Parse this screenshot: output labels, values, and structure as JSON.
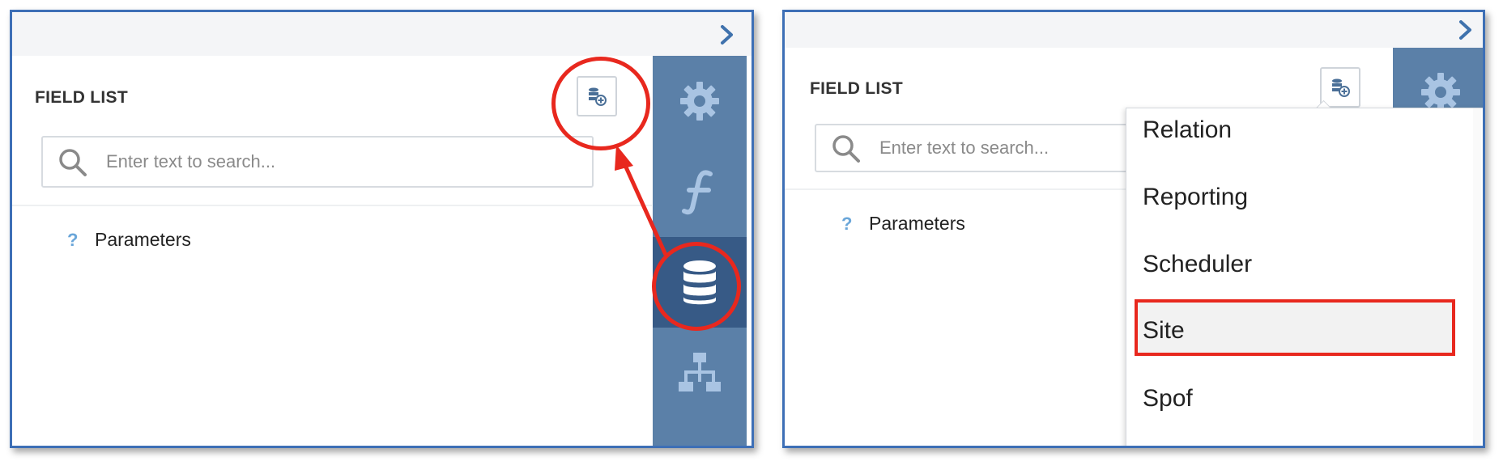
{
  "left_panel": {
    "title": "FIELD LIST",
    "search": {
      "placeholder": "Enter text to search..."
    },
    "tree": {
      "items": [
        {
          "label": "Parameters",
          "icon": "question-mark-icon"
        }
      ]
    },
    "sidebar": {
      "buttons": [
        {
          "name": "settings",
          "icon": "gear-icon",
          "active": false
        },
        {
          "name": "functions",
          "icon": "function-icon",
          "active": false
        },
        {
          "name": "data-sources",
          "icon": "database-icon",
          "active": true
        },
        {
          "name": "hierarchy",
          "icon": "hierarchy-icon",
          "active": false
        }
      ]
    },
    "annotations": {
      "color": "#e8281e"
    }
  },
  "right_panel": {
    "title": "FIELD LIST",
    "search": {
      "placeholder": "Enter text to search..."
    },
    "tree": {
      "items": [
        {
          "label": "Parameters",
          "icon": "question-mark-icon"
        }
      ]
    },
    "dropdown": {
      "items": [
        "Relation",
        "Reporting",
        "Scheduler",
        "Site",
        "Spof"
      ],
      "highlighted": "Site"
    }
  },
  "colors": {
    "sidebar": "#5b80a8",
    "sidebar_active": "#375a86",
    "border": "#3d6fb6",
    "annotation": "#e8281e",
    "accent": "#3f72ad"
  }
}
